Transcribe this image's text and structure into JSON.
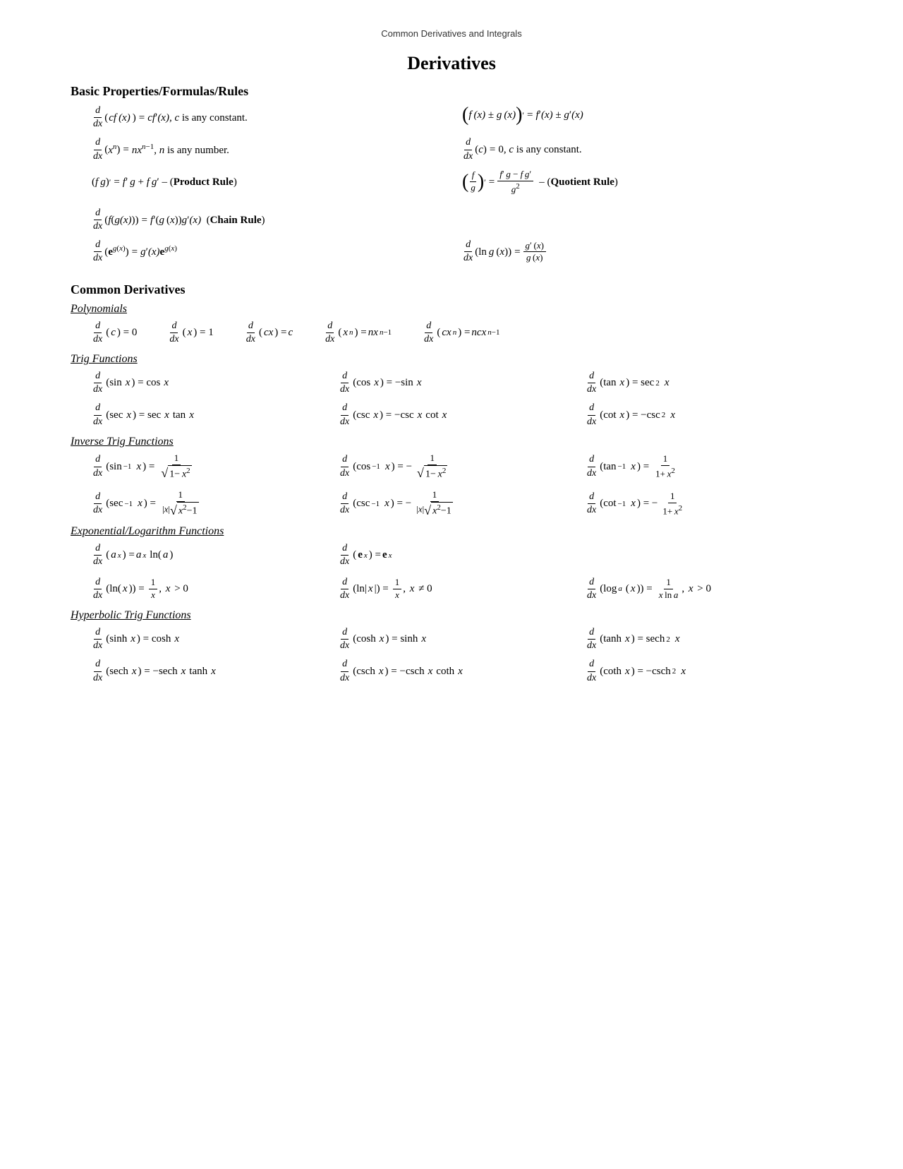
{
  "header": {
    "title": "Common Derivatives and Integrals"
  },
  "page": {
    "main_title": "Derivatives",
    "sections": {
      "basic": {
        "title": "Basic Properties/Formulas/Rules"
      },
      "common": {
        "title": "Common Derivatives",
        "polynomials": "Polynomials",
        "trig": "Trig Functions",
        "inverse_trig": "Inverse Trig Functions",
        "exp_log": "Exponential/Logarithm Functions",
        "hyperbolic": "Hyperbolic Trig Functions"
      }
    }
  }
}
